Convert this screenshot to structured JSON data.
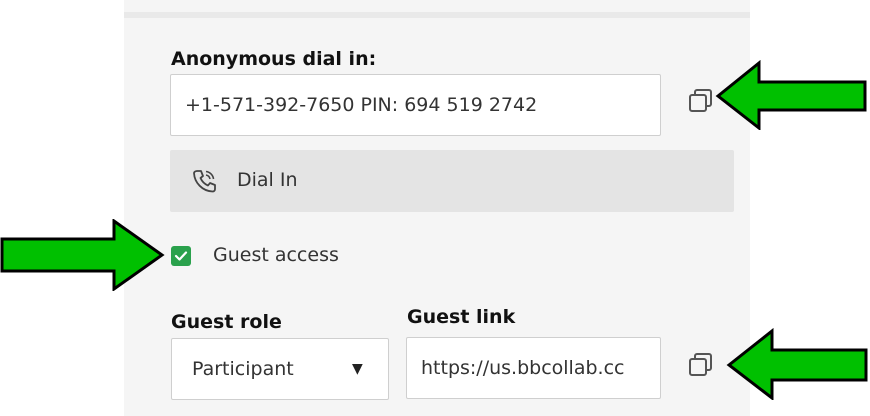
{
  "dial_in": {
    "label": "Anonymous dial in:",
    "value": "+1-571-392-7650 PIN: 694 519 2742",
    "button_label": "Dial In"
  },
  "guest_access": {
    "label": "Guest access",
    "checked": true
  },
  "guest_role": {
    "label": "Guest role",
    "selected": "Participant"
  },
  "guest_link": {
    "label": "Guest link",
    "value": "https://us.bbcollab.cc"
  },
  "colors": {
    "checkbox": "#2aa14c",
    "arrow_fill": "#00c000",
    "arrow_stroke": "#000000"
  },
  "icons": [
    "copy-icon",
    "phone-icon",
    "checkmark-icon",
    "caret-down-icon",
    "arrow-icon"
  ]
}
